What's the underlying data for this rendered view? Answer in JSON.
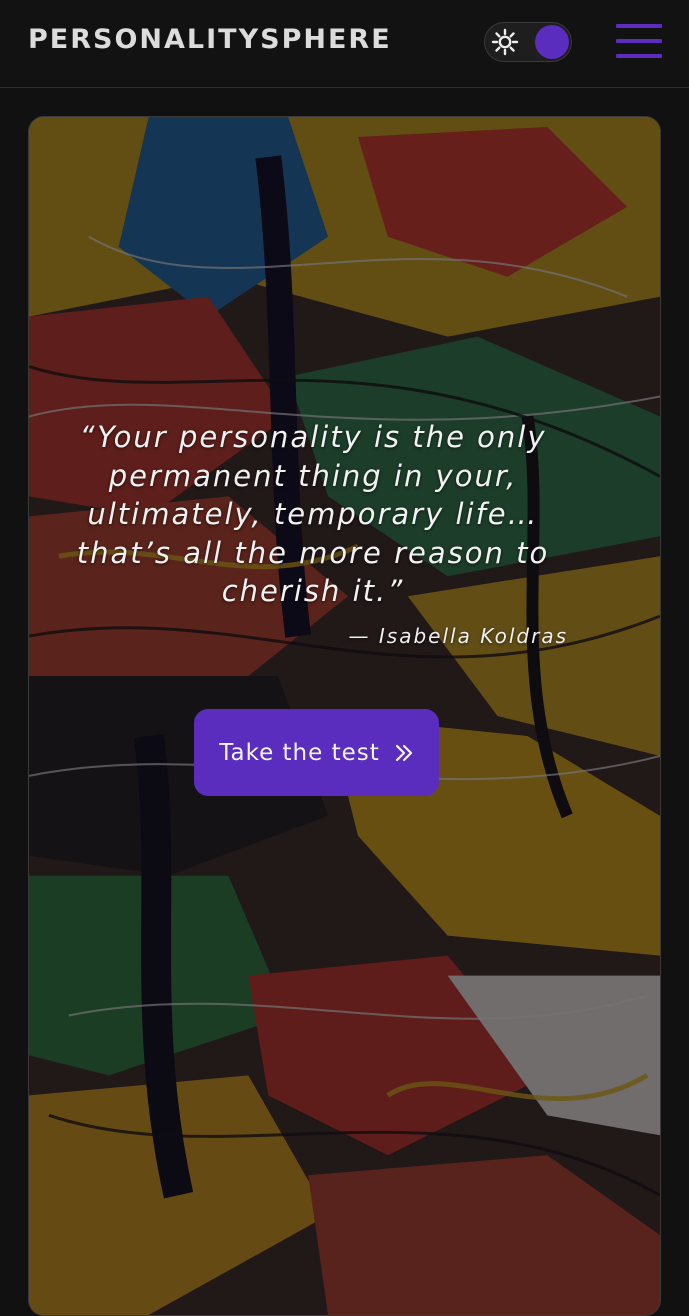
{
  "header": {
    "logo": "PERSONALITYSPHERE",
    "theme_toggle": {
      "icon": "sun-icon",
      "knob_color": "#5b2dbf"
    },
    "menu": {
      "icon": "hamburger-menu-icon"
    }
  },
  "hero": {
    "background": "abstract paint splatter",
    "quote": "“Your personality is the only permanent thing in your, ultimately, temporary life… that’s all the more reason to cherish it.”",
    "author": "— Isabella Koldras",
    "cta_label": "Take the test",
    "cta_icon": "double-chevron-right-icon"
  },
  "colors": {
    "accent": "#5b2dbf",
    "background": "#111111",
    "header_text": "#dcdcdc"
  }
}
